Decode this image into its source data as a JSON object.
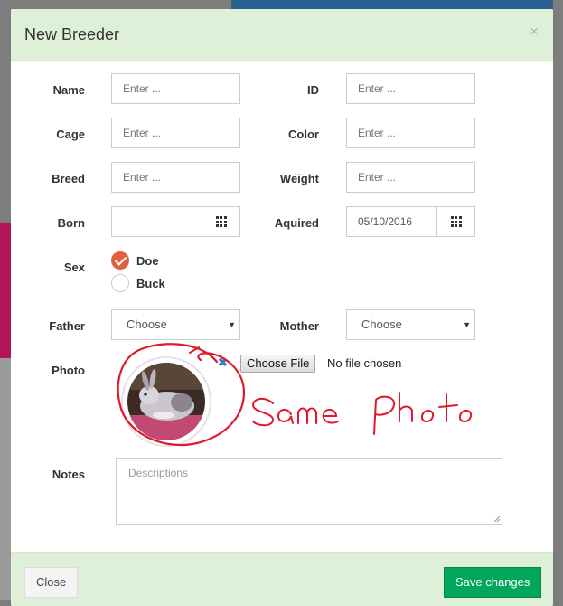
{
  "dialog": {
    "title": "New Breeder",
    "close_glyph": "×"
  },
  "fields": {
    "name": {
      "label": "Name",
      "placeholder": "Enter ..."
    },
    "id": {
      "label": "ID",
      "placeholder": "Enter ..."
    },
    "cage": {
      "label": "Cage",
      "placeholder": "Enter ..."
    },
    "color": {
      "label": "Color",
      "placeholder": "Enter ..."
    },
    "breed": {
      "label": "Breed",
      "placeholder": "Enter ..."
    },
    "weight": {
      "label": "Weight",
      "placeholder": "Enter ..."
    },
    "born": {
      "label": "Born",
      "value": ""
    },
    "aquired": {
      "label": "Aquired",
      "value": "05/10/2016"
    },
    "sex": {
      "label": "Sex",
      "options": [
        "Doe",
        "Buck"
      ],
      "selected": "Doe"
    },
    "father": {
      "label": "Father",
      "value": "Choose"
    },
    "mother": {
      "label": "Mother",
      "value": "Choose"
    },
    "photo": {
      "label": "Photo",
      "remove_glyph": "✖",
      "choose_label": "Choose File",
      "status": "No file chosen",
      "annotation": "Same Photo"
    },
    "notes": {
      "label": "Notes",
      "placeholder": "Descriptions"
    }
  },
  "footer": {
    "close_label": "Close",
    "save_label": "Save changes"
  },
  "colors": {
    "header_bg": "#dff0d8",
    "radio_checked": "#e0603b",
    "save_button": "#00a65a",
    "annotation_ink": "#e0182a"
  },
  "icons": [
    "close-icon",
    "calendar-grid-icon",
    "caret-down-icon",
    "checkmark-icon",
    "remove-icon"
  ]
}
